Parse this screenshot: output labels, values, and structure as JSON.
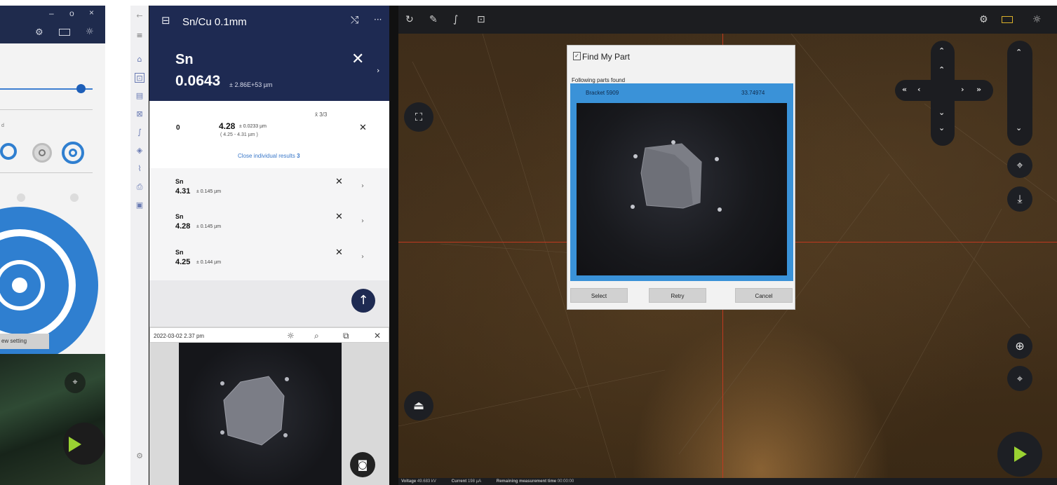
{
  "left_window": {
    "title_controls": {
      "minimize": "–",
      "maximize": "o",
      "close": "×"
    },
    "toolbar_icons": [
      "gear-icon",
      "camera-icon",
      "brightness-icon"
    ],
    "small_label": "d",
    "button_label": "ew setting"
  },
  "app": {
    "nav_back": "←",
    "header": {
      "title": "Sn/Cu 0.1mm",
      "shuffle": "⤭",
      "more": "···"
    },
    "summary": {
      "element": "Sn",
      "value": "0.0643",
      "uncertainty": "± 2.86E+53 µm",
      "close": "✕",
      "chevron": "›"
    },
    "detail": {
      "index": "0",
      "value": "4.28",
      "uncertainty": "± 0.0233 µm",
      "range": "( 4.25 - 4.31 µm )",
      "count": "x̄ 3/3",
      "close": "✕",
      "close_individual_label": "Close individual results",
      "close_individual_count": "3"
    },
    "results": [
      {
        "element": "Sn",
        "value": "4.31",
        "uncertainty": "± 0.145 µm"
      },
      {
        "element": "Sn",
        "value": "4.28",
        "uncertainty": "± 0.145 µm"
      },
      {
        "element": "Sn",
        "value": "4.25",
        "uncertainty": "± 0.144 µm"
      }
    ],
    "thumbnail": {
      "date": "2022-03-02 2.37 pm",
      "close": "✕"
    },
    "topbar_icons": [
      "refresh-icon",
      "pen-icon",
      "spectrum-icon",
      "find-part-icon",
      "gear-icon",
      "camera-icon",
      "brightness-icon"
    ],
    "status": {
      "voltage_label": "Voltage",
      "voltage": "49.683 kV",
      "current_label": "Current",
      "current": "198 µA",
      "remaining_label": "Remaining measurement time",
      "remaining": "00:00:00"
    },
    "nav": {
      "up2": "»",
      "left2": "«",
      "left1": "‹",
      "right1": "›",
      "right2": "»"
    }
  },
  "dialog": {
    "title": "Find My Part",
    "subtitle": "Following parts found",
    "result_name": "Bracket 5909",
    "result_score": "33.74974",
    "buttons": {
      "select": "Select",
      "retry": "Retry",
      "cancel": "Cancel"
    }
  },
  "colors": {
    "navy": "#1e2a52",
    "accent_blue": "#3a92d8",
    "play_green": "#9ad232",
    "crosshair": "#c0391f"
  }
}
